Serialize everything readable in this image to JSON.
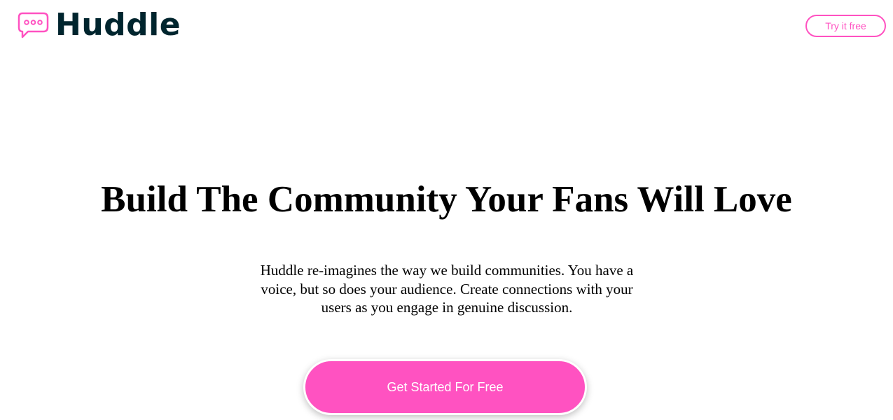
{
  "brand": {
    "name": "Huddle",
    "icon": "chat-bubble-icon",
    "accent_color": "#ff52c1",
    "text_color": "#00252e"
  },
  "header": {
    "cta_label": "Try it free"
  },
  "hero": {
    "title": "Build The Community Your Fans Will Love",
    "description": "Huddle re-imagines the way we build communities. You have a voice, but so does your audience. Create connections with your users as you engage in genuine discussion.",
    "cta_label": "Get Started For Free"
  }
}
